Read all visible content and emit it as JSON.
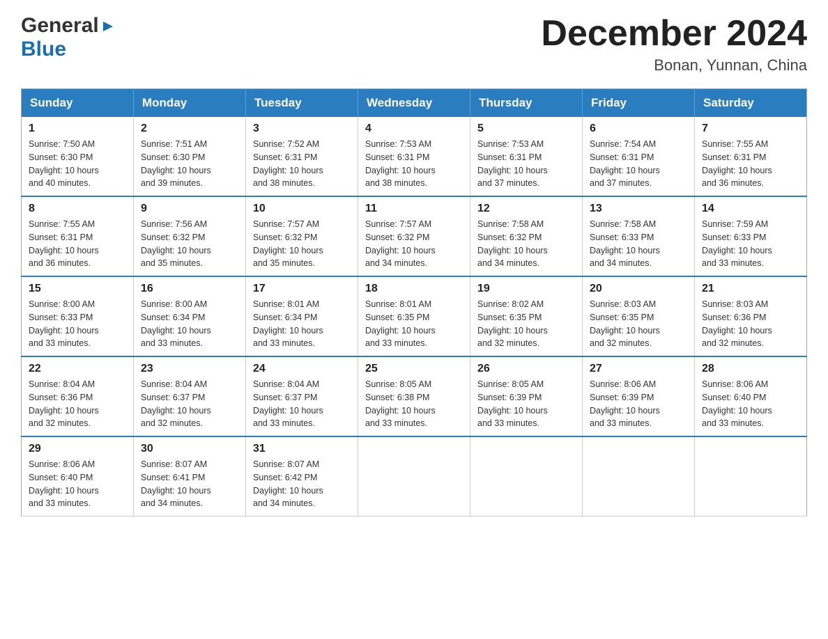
{
  "logo": {
    "general": "General",
    "blue": "Blue",
    "arrow": "▶"
  },
  "title": "December 2024",
  "subtitle": "Bonan, Yunnan, China",
  "headers": [
    "Sunday",
    "Monday",
    "Tuesday",
    "Wednesday",
    "Thursday",
    "Friday",
    "Saturday"
  ],
  "weeks": [
    [
      {
        "day": "1",
        "sunrise": "Sunrise: 7:50 AM",
        "sunset": "Sunset: 6:30 PM",
        "daylight": "Daylight: 10 hours",
        "daylight2": "and 40 minutes."
      },
      {
        "day": "2",
        "sunrise": "Sunrise: 7:51 AM",
        "sunset": "Sunset: 6:30 PM",
        "daylight": "Daylight: 10 hours",
        "daylight2": "and 39 minutes."
      },
      {
        "day": "3",
        "sunrise": "Sunrise: 7:52 AM",
        "sunset": "Sunset: 6:31 PM",
        "daylight": "Daylight: 10 hours",
        "daylight2": "and 38 minutes."
      },
      {
        "day": "4",
        "sunrise": "Sunrise: 7:53 AM",
        "sunset": "Sunset: 6:31 PM",
        "daylight": "Daylight: 10 hours",
        "daylight2": "and 38 minutes."
      },
      {
        "day": "5",
        "sunrise": "Sunrise: 7:53 AM",
        "sunset": "Sunset: 6:31 PM",
        "daylight": "Daylight: 10 hours",
        "daylight2": "and 37 minutes."
      },
      {
        "day": "6",
        "sunrise": "Sunrise: 7:54 AM",
        "sunset": "Sunset: 6:31 PM",
        "daylight": "Daylight: 10 hours",
        "daylight2": "and 37 minutes."
      },
      {
        "day": "7",
        "sunrise": "Sunrise: 7:55 AM",
        "sunset": "Sunset: 6:31 PM",
        "daylight": "Daylight: 10 hours",
        "daylight2": "and 36 minutes."
      }
    ],
    [
      {
        "day": "8",
        "sunrise": "Sunrise: 7:55 AM",
        "sunset": "Sunset: 6:31 PM",
        "daylight": "Daylight: 10 hours",
        "daylight2": "and 36 minutes."
      },
      {
        "day": "9",
        "sunrise": "Sunrise: 7:56 AM",
        "sunset": "Sunset: 6:32 PM",
        "daylight": "Daylight: 10 hours",
        "daylight2": "and 35 minutes."
      },
      {
        "day": "10",
        "sunrise": "Sunrise: 7:57 AM",
        "sunset": "Sunset: 6:32 PM",
        "daylight": "Daylight: 10 hours",
        "daylight2": "and 35 minutes."
      },
      {
        "day": "11",
        "sunrise": "Sunrise: 7:57 AM",
        "sunset": "Sunset: 6:32 PM",
        "daylight": "Daylight: 10 hours",
        "daylight2": "and 34 minutes."
      },
      {
        "day": "12",
        "sunrise": "Sunrise: 7:58 AM",
        "sunset": "Sunset: 6:32 PM",
        "daylight": "Daylight: 10 hours",
        "daylight2": "and 34 minutes."
      },
      {
        "day": "13",
        "sunrise": "Sunrise: 7:58 AM",
        "sunset": "Sunset: 6:33 PM",
        "daylight": "Daylight: 10 hours",
        "daylight2": "and 34 minutes."
      },
      {
        "day": "14",
        "sunrise": "Sunrise: 7:59 AM",
        "sunset": "Sunset: 6:33 PM",
        "daylight": "Daylight: 10 hours",
        "daylight2": "and 33 minutes."
      }
    ],
    [
      {
        "day": "15",
        "sunrise": "Sunrise: 8:00 AM",
        "sunset": "Sunset: 6:33 PM",
        "daylight": "Daylight: 10 hours",
        "daylight2": "and 33 minutes."
      },
      {
        "day": "16",
        "sunrise": "Sunrise: 8:00 AM",
        "sunset": "Sunset: 6:34 PM",
        "daylight": "Daylight: 10 hours",
        "daylight2": "and 33 minutes."
      },
      {
        "day": "17",
        "sunrise": "Sunrise: 8:01 AM",
        "sunset": "Sunset: 6:34 PM",
        "daylight": "Daylight: 10 hours",
        "daylight2": "and 33 minutes."
      },
      {
        "day": "18",
        "sunrise": "Sunrise: 8:01 AM",
        "sunset": "Sunset: 6:35 PM",
        "daylight": "Daylight: 10 hours",
        "daylight2": "and 33 minutes."
      },
      {
        "day": "19",
        "sunrise": "Sunrise: 8:02 AM",
        "sunset": "Sunset: 6:35 PM",
        "daylight": "Daylight: 10 hours",
        "daylight2": "and 32 minutes."
      },
      {
        "day": "20",
        "sunrise": "Sunrise: 8:03 AM",
        "sunset": "Sunset: 6:35 PM",
        "daylight": "Daylight: 10 hours",
        "daylight2": "and 32 minutes."
      },
      {
        "day": "21",
        "sunrise": "Sunrise: 8:03 AM",
        "sunset": "Sunset: 6:36 PM",
        "daylight": "Daylight: 10 hours",
        "daylight2": "and 32 minutes."
      }
    ],
    [
      {
        "day": "22",
        "sunrise": "Sunrise: 8:04 AM",
        "sunset": "Sunset: 6:36 PM",
        "daylight": "Daylight: 10 hours",
        "daylight2": "and 32 minutes."
      },
      {
        "day": "23",
        "sunrise": "Sunrise: 8:04 AM",
        "sunset": "Sunset: 6:37 PM",
        "daylight": "Daylight: 10 hours",
        "daylight2": "and 32 minutes."
      },
      {
        "day": "24",
        "sunrise": "Sunrise: 8:04 AM",
        "sunset": "Sunset: 6:37 PM",
        "daylight": "Daylight: 10 hours",
        "daylight2": "and 33 minutes."
      },
      {
        "day": "25",
        "sunrise": "Sunrise: 8:05 AM",
        "sunset": "Sunset: 6:38 PM",
        "daylight": "Daylight: 10 hours",
        "daylight2": "and 33 minutes."
      },
      {
        "day": "26",
        "sunrise": "Sunrise: 8:05 AM",
        "sunset": "Sunset: 6:39 PM",
        "daylight": "Daylight: 10 hours",
        "daylight2": "and 33 minutes."
      },
      {
        "day": "27",
        "sunrise": "Sunrise: 8:06 AM",
        "sunset": "Sunset: 6:39 PM",
        "daylight": "Daylight: 10 hours",
        "daylight2": "and 33 minutes."
      },
      {
        "day": "28",
        "sunrise": "Sunrise: 8:06 AM",
        "sunset": "Sunset: 6:40 PM",
        "daylight": "Daylight: 10 hours",
        "daylight2": "and 33 minutes."
      }
    ],
    [
      {
        "day": "29",
        "sunrise": "Sunrise: 8:06 AM",
        "sunset": "Sunset: 6:40 PM",
        "daylight": "Daylight: 10 hours",
        "daylight2": "and 33 minutes."
      },
      {
        "day": "30",
        "sunrise": "Sunrise: 8:07 AM",
        "sunset": "Sunset: 6:41 PM",
        "daylight": "Daylight: 10 hours",
        "daylight2": "and 34 minutes."
      },
      {
        "day": "31",
        "sunrise": "Sunrise: 8:07 AM",
        "sunset": "Sunset: 6:42 PM",
        "daylight": "Daylight: 10 hours",
        "daylight2": "and 34 minutes."
      },
      null,
      null,
      null,
      null
    ]
  ]
}
